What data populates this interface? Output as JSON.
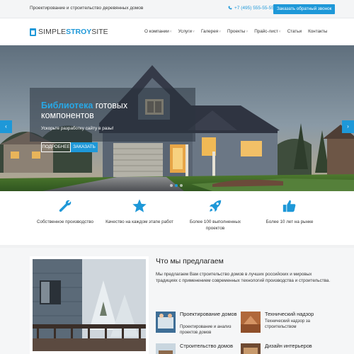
{
  "topbar": {
    "tagline": "Проектирование и строительство деревянных домов",
    "phone": "+7 (495) 555-55-55",
    "callback_label": "Заказать обратный звонок"
  },
  "header": {
    "logo": {
      "part1": "SIMPLE",
      "part2": "STROY",
      "part3": "SITE"
    },
    "nav": [
      {
        "label": "О компании",
        "dropdown": true
      },
      {
        "label": "Услуги",
        "dropdown": true
      },
      {
        "label": "Галерея",
        "dropdown": true
      },
      {
        "label": "Проекты",
        "dropdown": true
      },
      {
        "label": "Прайс-лист",
        "dropdown": true
      },
      {
        "label": "Статьи",
        "dropdown": false
      },
      {
        "label": "Контакты",
        "dropdown": false
      }
    ],
    "dropdown_glyph": "˅"
  },
  "hero": {
    "title_highlight": "Библиотека",
    "title_rest": " готовых компонентов",
    "subtitle": "Ускорьте разработку сайту в разы!",
    "more_label": "ПОДРОБНЕЕ",
    "order_label": "ЗАКАЗАТЬ",
    "prev_glyph": "‹",
    "next_glyph": "›",
    "slides_count": 3,
    "active_slide": 2
  },
  "features": [
    {
      "icon": "wrench-icon",
      "text": "Собственное производство"
    },
    {
      "icon": "star-icon",
      "text": "Качество на каждом этапе работ"
    },
    {
      "icon": "rocket-icon",
      "text": "Более 100 выполненных проектов"
    },
    {
      "icon": "thumbs-up-icon",
      "text": "Более 10 лет на рынке"
    }
  ],
  "offer": {
    "title": "Что мы предлагаем",
    "description": "Мы предлагаем Вам строительство домов в лучших российских и мировых традициях с применением современных технологий производства и строительства.",
    "services": [
      {
        "title": "Проектирование домов",
        "desc": "Проектирование и анализ проектов домов"
      },
      {
        "title": "Технический надзор",
        "desc": "Технический надзор за строительством"
      },
      {
        "title": "Строительство домов",
        "desc": ""
      },
      {
        "title": "Дизайн интерьеров",
        "desc": ""
      }
    ]
  },
  "colors": {
    "accent": "#1e98d8",
    "topbar_bg": "#f4f5f6",
    "section_bg": "#f5f6f7"
  }
}
